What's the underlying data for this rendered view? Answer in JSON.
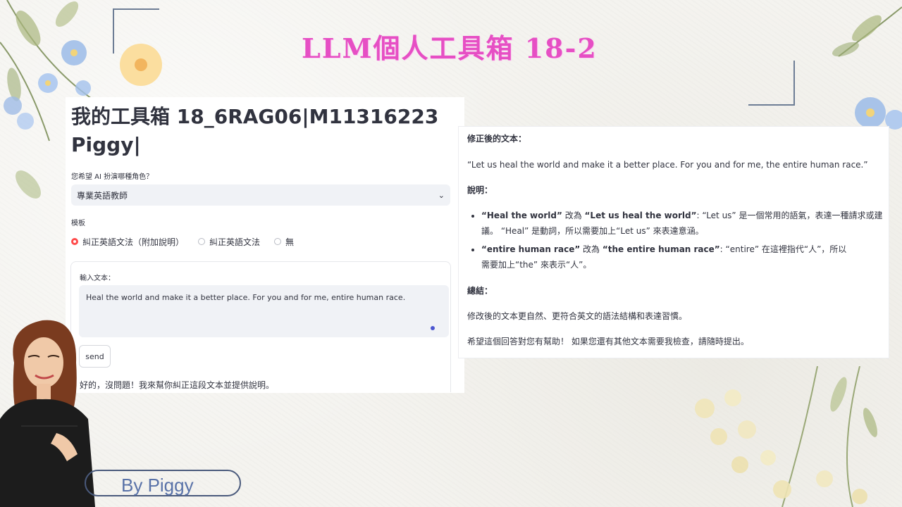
{
  "slide": {
    "title": "LLM個人工具箱 18-2",
    "byline": "By Piggy"
  },
  "app": {
    "title": "我的工具箱 18_6RAG06|M11316223 Piggy|",
    "role_label": "您希望 AI 扮演哪種角色？",
    "role_selected": "專業英語教師",
    "template_label": "模板",
    "template_options": [
      {
        "label": "糾正英語文法（附加說明）",
        "checked": true
      },
      {
        "label": "糾正英語文法",
        "checked": false
      },
      {
        "label": "無",
        "checked": false
      }
    ],
    "input_label": "輸入文本：",
    "input_value": "Heal the world and make it a better place. For you and for me, entire human race.",
    "send_label": "send",
    "reply": "好的，沒問題！我來幫你糾正這段文本並提供說明。"
  },
  "result": {
    "corrected_heading": "修正後的文本：",
    "corrected_text": "“Let us heal the world and make it a better place. For you and for me, the entire human race.”",
    "explain_heading": "說明：",
    "bullets": [
      {
        "from": "“Heal the world”",
        "mid": " 改為 ",
        "to": "“Let us heal the world”",
        "rest": ": “Let us” 是一個常用的語氣，表達一種請求或建議。 “Heal” 是動詞，所以需要加上“Let us” 來表達意涵。"
      },
      {
        "from": "“entire human race”",
        "mid": " 改為 ",
        "to": "“the entire human race”",
        "rest": ": “entire” 在這裡指代“人”，所以需要加上“the” 來表示“人”。"
      }
    ],
    "summary_heading": "總結：",
    "summary_text": "修改後的文本更自然、更符合英文的語法結構和表達習慣。",
    "closing_text": "希望這個回答對您有幫助！ 如果您還有其他文本需要我檢查，請隨時提出。"
  },
  "colors": {
    "title_pink": "#e64fc4",
    "radio_red": "#ff4b4b",
    "byline_blue": "#5972a8",
    "corner_slate": "#6d7d95"
  }
}
